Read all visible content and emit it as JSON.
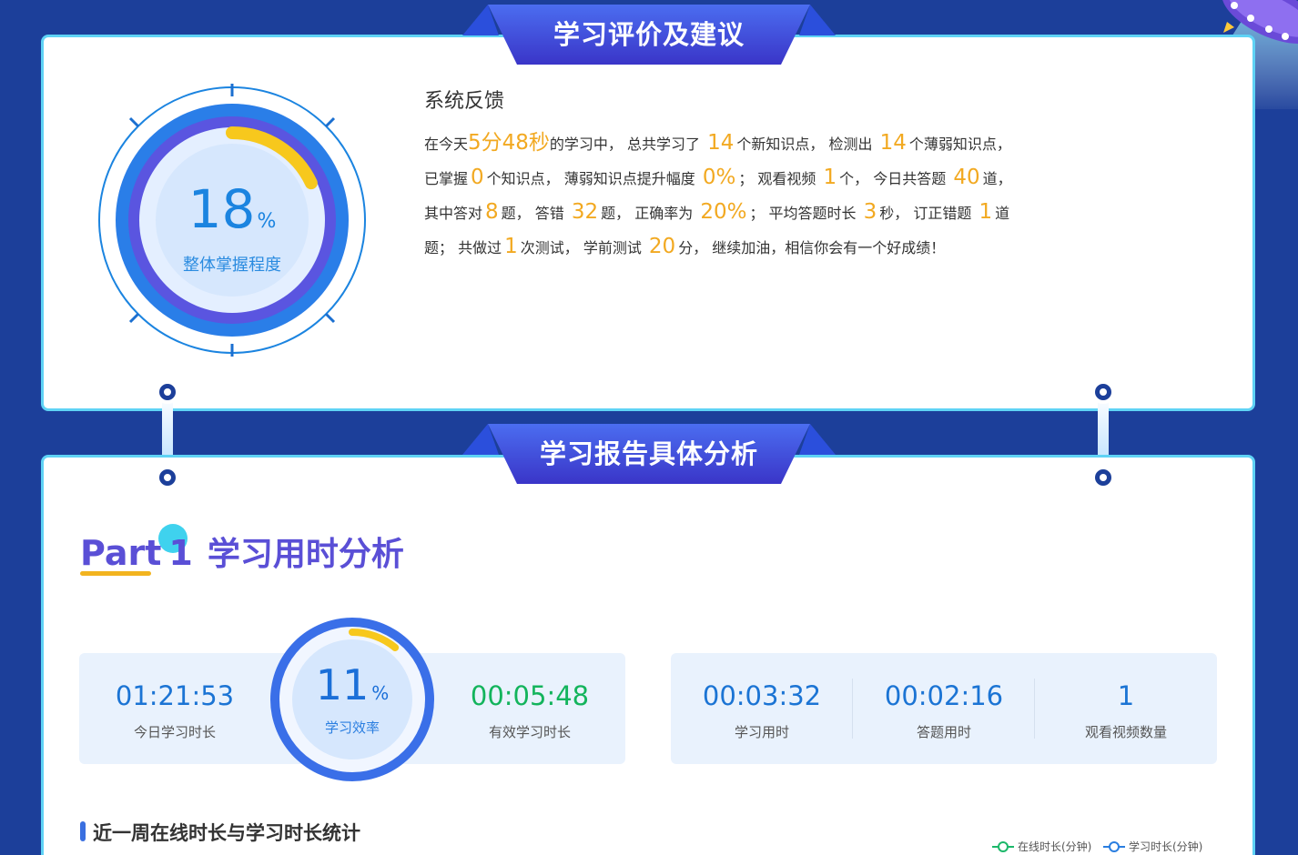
{
  "section1": {
    "ribbon_title": "学习评价及建议",
    "gauge": {
      "value": "18",
      "unit": "%",
      "label": "整体掌握程度",
      "fraction": 0.18
    },
    "feedback": {
      "title": "系统反馈",
      "t1": "在今天",
      "study_time": "5分48秒",
      "t2": "的学习中， 总共学习了",
      "new_points": "14",
      "t3": "个新知识点， 检测出",
      "weak_points": "14",
      "t4": "个薄弱知识点，",
      "t5": "已掌握",
      "mastered": "0",
      "t6": "个知识点， 薄弱知识点提升幅度",
      "improve": "0%",
      "t7": "； 观看视频",
      "videos": "1",
      "t8": "个， 今日共答题",
      "answered": "40",
      "t9": "道，",
      "t10": "其中答对",
      "correct": "8",
      "t11": "题， 答错",
      "wrong": "32",
      "t12": "题， 正确率为",
      "accuracy": "20%",
      "t13": "； 平均答题时长",
      "avg_time": "3",
      "t14": "秒， 订正错题",
      "corrected": "1",
      "t15": "道",
      "t16": "题； 共做过",
      "tests": "1",
      "t17": "次测试， 学前测试",
      "pretest": "20",
      "t18": "分， 继续加油，相信你会有一个好成绩！"
    }
  },
  "section2": {
    "ribbon_title": "学习报告具体分析",
    "part": {
      "word": "Part",
      "num": "1",
      "heading": "学习用时分析"
    },
    "left_stats": {
      "today": {
        "value": "01:21:53",
        "label": "今日学习时长"
      },
      "efficiency": {
        "value": "11",
        "unit": "%",
        "label": "学习效率",
        "fraction": 0.11
      },
      "effective": {
        "value": "00:05:48",
        "label": "有效学习时长"
      }
    },
    "right_stats": [
      {
        "value": "00:03:32",
        "label": "学习用时"
      },
      {
        "value": "00:02:16",
        "label": "答题用时"
      },
      {
        "value": "1",
        "label": "观看视频数量"
      }
    ],
    "week": {
      "title": "近一周在线时长与学习时长统计",
      "legend": [
        {
          "label": "在线时长(分钟)",
          "color": "#1cb86a"
        },
        {
          "label": "学习时长(分钟)",
          "color": "#2a7ee0"
        }
      ]
    }
  },
  "colors": {
    "background": "#1c3f9a",
    "accent_gold": "#f2a921",
    "blue": "#1b84e0",
    "purple": "#5a4fd6",
    "green": "#13b45c"
  }
}
